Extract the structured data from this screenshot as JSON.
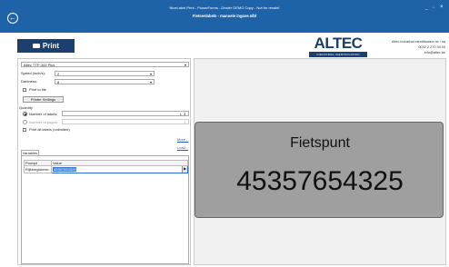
{
  "window": {
    "app_title": "NiceLabel Print - PowerForms - Dealer DEMO Copy - Not for resale!",
    "file_title": "Fietsenlabels - manuele ingave.nlbl",
    "minimize": "_",
    "maximize": "▫",
    "close": "×"
  },
  "toolbar": {
    "print_label": "Print",
    "back_icon": "←"
  },
  "brand": {
    "logo_word": "ALTEC",
    "logo_sub": "INDUSTRIAL IDENTIFICATION",
    "company_lines": [
      "Altec industrial identification nv / sa",
      "0032 2 270 34 00",
      "info@altec.be"
    ],
    "accent": "#1b3f6e",
    "titlebar_color": "#1e63a8"
  },
  "printer": {
    "selected": "Altec TTP-343 Plus",
    "speed_label": "Speed (inch/s):",
    "speed_value": "2",
    "darkness_label": "Darkness:",
    "darkness_value": "8",
    "print_to_file_label": "Print to file",
    "settings_button": "Printer Settings"
  },
  "quantity": {
    "section_label": "Quantity",
    "labels_option": "Number of labels:",
    "labels_value": "1",
    "pages_option": "Number of pages:",
    "all_labels_option": "Print all labels (unlimited)",
    "more_link": "More...",
    "load_link": "Load..."
  },
  "variables": {
    "tab_label": "Variables",
    "col_prompt": "Prompt",
    "col_value": "Value",
    "rows": [
      {
        "prompt": "Rijksregisternr:",
        "value": "45357654325"
      }
    ]
  },
  "preview": {
    "label_title": "Fietspunt",
    "label_number": "45357654325"
  }
}
